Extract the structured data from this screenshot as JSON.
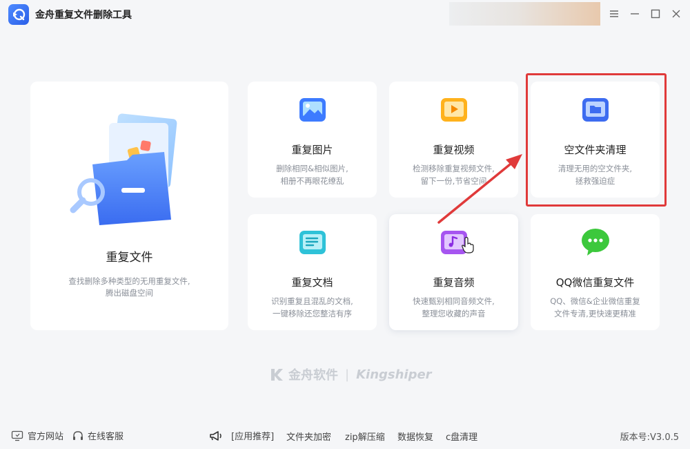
{
  "app": {
    "title": "金舟重复文件删除工具"
  },
  "cards": {
    "duplicate_files": {
      "title": "重复文件",
      "desc1": "查找删除多种类型的无用重复文件,",
      "desc2": "腾出磁盘空间"
    },
    "duplicate_images": {
      "title": "重复图片",
      "desc1": "删除相同&相似图片,",
      "desc2": "相册不再眼花缭乱"
    },
    "duplicate_videos": {
      "title": "重复视频",
      "desc1": "检测移除重复视频文件,",
      "desc2": "留下一份,节省空间"
    },
    "empty_folders": {
      "title": "空文件夹清理",
      "desc1": "清理无用的空文件夹,",
      "desc2": "拯救强迫症"
    },
    "duplicate_docs": {
      "title": "重复文档",
      "desc1": "识别重复且混乱的文档,",
      "desc2": "一键移除还您整洁有序"
    },
    "duplicate_audio": {
      "title": "重复音频",
      "desc1": "快速甄别相同音频文件,",
      "desc2": "整理您收藏的声音"
    },
    "qq_wechat": {
      "title": "QQ微信重复文件",
      "desc1": "QQ、微信&企业微信重复",
      "desc2": "文件专清,更快速更精准"
    }
  },
  "brand": {
    "cn": "金舟软件",
    "sep": "|",
    "en": "Kingshiper"
  },
  "footer": {
    "official_site": "官方网站",
    "online_service": "在线客服",
    "app_recommend": "[应用推荐]",
    "links": [
      "文件夹加密",
      "zip解压缩",
      "数据恢复",
      "c盘清理"
    ],
    "version": "版本号:V3.0.5"
  },
  "colors": {
    "accent": "#3d7bff",
    "highlight": "#e03a3a"
  }
}
